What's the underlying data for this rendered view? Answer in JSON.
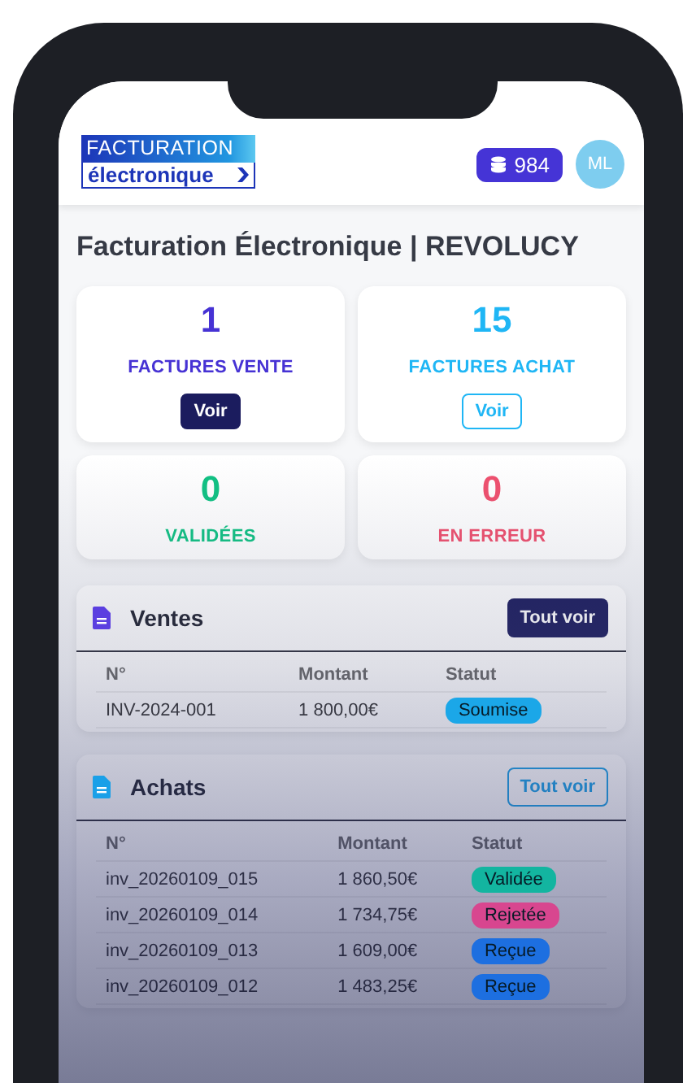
{
  "header": {
    "logo": {
      "top": "FACTURATION",
      "bottom": "électronique"
    },
    "credits": "984",
    "avatar": "ML"
  },
  "title": "Facturation Électronique | REVOLUCY",
  "stats": [
    {
      "value": "1",
      "label": "FACTURES VENTE",
      "color": "#4632d4",
      "button": {
        "label": "Voir",
        "kind": "filled"
      }
    },
    {
      "value": "15",
      "label": "FACTURES ACHAT",
      "color": "#1fb6f5",
      "button": {
        "label": "Voir",
        "kind": "outline"
      }
    },
    {
      "value": "0",
      "label": "VALIDÉES",
      "color": "#10c283"
    },
    {
      "value": "0",
      "label": "EN ERREUR",
      "color": "#f0506e"
    }
  ],
  "sections": [
    {
      "title": "Ventes",
      "color": "#5b3fe0",
      "button": {
        "label": "Tout voir",
        "kind": "filled"
      },
      "columns": [
        "N°",
        "Montant",
        "Statut"
      ],
      "rows": [
        {
          "number": "INV-2024-001",
          "amount": "1 800,00€",
          "status": {
            "label": "Soumise",
            "color": "#1ba7e8"
          }
        }
      ]
    },
    {
      "title": "Achats",
      "color": "#1aa0e8",
      "button": {
        "label": "Tout voir",
        "kind": "outline"
      },
      "columns": [
        "N°",
        "Montant",
        "Statut"
      ],
      "rows": [
        {
          "number": "inv_20260109_015",
          "amount": "1 860,50€",
          "status": {
            "label": "Validée",
            "color": "#13b5a0"
          }
        },
        {
          "number": "inv_20260109_014",
          "amount": "1 734,75€",
          "status": {
            "label": "Rejetée",
            "color": "#d8468f"
          }
        },
        {
          "number": "inv_20260109_013",
          "amount": "1 609,00€",
          "status": {
            "label": "Reçue",
            "color": "#1d6fe0"
          }
        },
        {
          "number": "inv_20260109_012",
          "amount": "1 483,25€",
          "status": {
            "label": "Reçue",
            "color": "#1d6fe0"
          }
        }
      ]
    }
  ]
}
